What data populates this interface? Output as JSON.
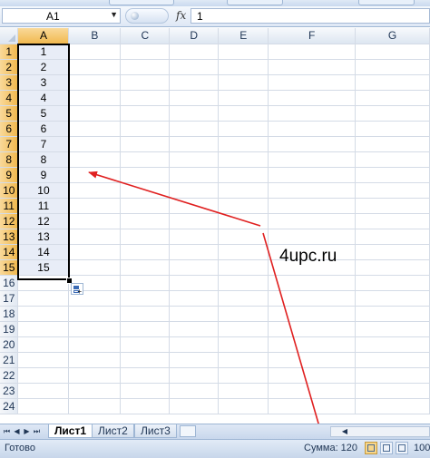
{
  "name_box": {
    "value": "A1"
  },
  "formula_bar": {
    "fx_label": "fx",
    "value": "1"
  },
  "columns": [
    "A",
    "B",
    "C",
    "D",
    "E",
    "F",
    "G"
  ],
  "rows": [
    "1",
    "2",
    "3",
    "4",
    "5",
    "6",
    "7",
    "8",
    "9",
    "10",
    "11",
    "12",
    "13",
    "14",
    "15",
    "16",
    "17",
    "18",
    "19",
    "20",
    "21",
    "22",
    "23",
    "24"
  ],
  "column_a_values": [
    "1",
    "2",
    "3",
    "4",
    "5",
    "6",
    "7",
    "8",
    "9",
    "10",
    "11",
    "12",
    "13",
    "14",
    "15"
  ],
  "annotation": {
    "site": "4upc.ru",
    "arrow_color": "#e02020"
  },
  "sheet_tabs": [
    "Лист1",
    "Лист2",
    "Лист3"
  ],
  "active_sheet": "Лист1",
  "status": {
    "ready": "Готово",
    "sum": "Сумма: 120",
    "zoom": "100"
  },
  "colors": {
    "selection_header": "#f1b94f",
    "selection_fill": "#e8edf7",
    "chrome": "#c8d7ec"
  }
}
